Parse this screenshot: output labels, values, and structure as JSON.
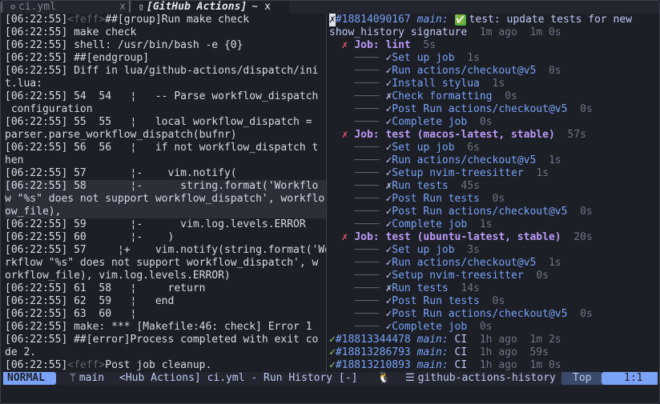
{
  "tabs": {
    "inactive": {
      "icon": "gear-icon",
      "name": "ci.yml",
      "close": "x"
    },
    "active": {
      "icon": "file-icon",
      "name": "[GitHub Actions]",
      "modified": "~",
      "close": "x"
    }
  },
  "log_lines": [
    {
      "ts": "[06:22:55]",
      "feff": "<feff>",
      "text": "##[group]Run make check"
    },
    {
      "ts": "[06:22:55]",
      "text": " make check"
    },
    {
      "ts": "[06:22:55]",
      "text": " shell: /usr/bin/bash -e {0}"
    },
    {
      "ts": "[06:22:55]",
      "text": " ##[endgroup]"
    },
    {
      "ts": "[06:22:55]",
      "text": " Diff in lua/github-actions/dispatch/ini"
    },
    {
      "ts": "",
      "text": "t.lua:"
    },
    {
      "ts": "[06:22:55]",
      "text": " 54  54   ¦   -- Parse workflow_dispatch"
    },
    {
      "ts": "",
      "text": " configuration"
    },
    {
      "ts": "[06:22:55]",
      "text": " 55  55   ¦   local workflow_dispatch ="
    },
    {
      "ts": "",
      "text": "parser.parse_workflow_dispatch(bufnr)"
    },
    {
      "ts": "[06:22:55]",
      "text": " 56  56   ¦   if not workflow_dispatch t"
    },
    {
      "ts": "",
      "text": "hen"
    },
    {
      "ts": "[06:22:55]",
      "text": " 57       ¦-    vim.notify("
    },
    {
      "ts": "[06:22:55]",
      "text": " 58       ¦-      string.format('Workflo",
      "hl": true
    },
    {
      "ts": "",
      "text": "w \"%s\" does not support workflow_dispatch', workflo",
      "hl": true
    },
    {
      "ts": "",
      "text": "ow_file),",
      "hl": true
    },
    {
      "ts": "[06:22:55]",
      "text": " 59       ¦-      vim.log.levels.ERROR"
    },
    {
      "ts": "[06:22:55]",
      "text": " 60       ¦-    )"
    },
    {
      "ts": "[06:22:55]",
      "text": " 57     ¦+    vim.notify(string.format('Wo"
    },
    {
      "ts": "",
      "text": "rkflow \"%s\" does not support workflow_dispatch', w"
    },
    {
      "ts": "",
      "text": "orkflow_file), vim.log.levels.ERROR)"
    },
    {
      "ts": "[06:22:55]",
      "text": " 61  58   ¦     return"
    },
    {
      "ts": "[06:22:55]",
      "text": " 62  59   ¦   end"
    },
    {
      "ts": "[06:22:55]",
      "text": " 63  60   ¦"
    },
    {
      "ts": "[06:22:55]",
      "text": " make: *** [Makefile:46: check] Error 1"
    },
    {
      "ts": "[06:22:55]",
      "text": " ##[error]Process completed with exit co"
    },
    {
      "ts": "",
      "text": "de 2."
    },
    {
      "ts": "[06:22:55]",
      "feff": "<feff>",
      "text": "Post job cleanup."
    }
  ],
  "history": {
    "current_run": {
      "status_icon": "x-box-icon",
      "id": "#18814090167",
      "branch": "main:",
      "check_icon": "✅",
      "title": "test: update tests for new",
      "title_cont": "show_history signature",
      "ago": "1m ago",
      "duration": "1m 0s"
    },
    "jobs": [
      {
        "status": "✗",
        "label": "Job: lint",
        "duration": "5s",
        "steps": [
          {
            "status": "✓",
            "name": "Set up job",
            "duration": "1s"
          },
          {
            "status": "✓",
            "name": "Run actions/checkout@v5",
            "duration": "0s"
          },
          {
            "status": "✓",
            "name": "Install stylua",
            "duration": "1s"
          },
          {
            "status": "✗",
            "name": "Check formatting",
            "duration": "0s"
          },
          {
            "status": "✓",
            "name": "Post Run actions/checkout@v5",
            "duration": "0s"
          },
          {
            "status": "✓",
            "name": "Complete job",
            "duration": "0s"
          }
        ]
      },
      {
        "status": "✗",
        "label": "Job: test (macos-latest, stable)",
        "duration": "57s",
        "steps": [
          {
            "status": "✓",
            "name": "Set up job",
            "duration": "6s"
          },
          {
            "status": "✓",
            "name": "Run actions/checkout@v5",
            "duration": "1s"
          },
          {
            "status": "✓",
            "name": "Setup nvim-treesitter",
            "duration": "1s"
          },
          {
            "status": "✗",
            "name": "Run tests",
            "duration": "45s"
          },
          {
            "status": "✓",
            "name": "Post Run tests",
            "duration": "0s"
          },
          {
            "status": "✓",
            "name": "Post Run actions/checkout@v5",
            "duration": "0s"
          },
          {
            "status": "✓",
            "name": "Complete job",
            "duration": "1s"
          }
        ]
      },
      {
        "status": "✗",
        "label": "Job: test (ubuntu-latest, stable)",
        "duration": "20s",
        "steps": [
          {
            "status": "✓",
            "name": "Set up job",
            "duration": "3s"
          },
          {
            "status": "✓",
            "name": "Run actions/checkout@v5",
            "duration": "1s"
          },
          {
            "status": "✓",
            "name": "Setup nvim-treesitter",
            "duration": "0s"
          },
          {
            "status": "✗",
            "name": "Run tests",
            "duration": "14s"
          },
          {
            "status": "✓",
            "name": "Post Run tests",
            "duration": "0s"
          },
          {
            "status": "✓",
            "name": "Post Run actions/checkout@v5",
            "duration": "0s"
          },
          {
            "status": "✓",
            "name": "Complete job",
            "duration": "0s"
          }
        ]
      }
    ],
    "other_runs": [
      {
        "status": "✓",
        "id": "#18813344478",
        "branch": "main:",
        "name": "CI",
        "ago": "1h ago",
        "duration": "1m 2s"
      },
      {
        "status": "✓",
        "id": "#18813286793",
        "branch": "main:",
        "name": "CI",
        "ago": "1h ago",
        "duration": "59s"
      },
      {
        "status": "✓",
        "id": "#18813210893",
        "branch": "main:",
        "name": "CI",
        "ago": "1h ago",
        "duration": "1m 0s"
      }
    ]
  },
  "statusline": {
    "mode": "NORMAL",
    "branch_icon": "git-branch-icon",
    "branch": "main",
    "file": "<Hub Actions] ci.yml - Run History [-]",
    "lsp_icon": "linux-penguin-icon",
    "buffer_name": "github-actions-history",
    "position_top": "Top",
    "position": "1:1"
  },
  "colors": {
    "background": "#1c1f26",
    "accent_blue": "#7aa2f7",
    "success_green": "#9ece6a",
    "failure_red": "#e0556a",
    "job_purple": "#bb9af7"
  }
}
